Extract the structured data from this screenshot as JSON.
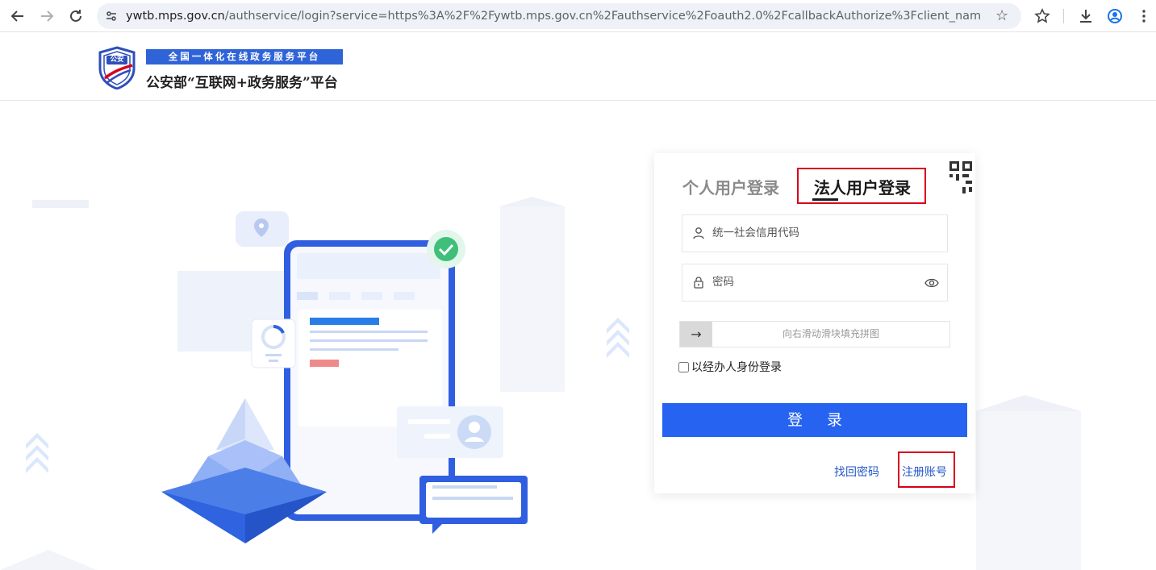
{
  "browser": {
    "url_host": "ywtb.mps.gov.cn",
    "url_rest": "/authservice/login?service=https%3A%2F%2Fywtb.mps.gov.cn%2Fauthservice%2Foauth2.0%2FcallbackAuthorize%3Fclient_name%3DCasO..."
  },
  "header": {
    "badge_text": "公安",
    "tagline": "全国一体化在线政务服务平台",
    "title": "公安部“互联网+政务服务”平台"
  },
  "login": {
    "tabs": [
      "个人用户登录",
      "法人用户登录"
    ],
    "active_tab": 1,
    "credit_code_placeholder": "统一社会信用代码",
    "password_placeholder": "密码",
    "slider_arrow": "→",
    "slider_text": "向右滑动滑块填充拼图",
    "agent_label": "以经办人身份登录",
    "agent_checked": false,
    "submit_label": "登 录",
    "forgot_label": "找回密码",
    "register_label": "注册账号"
  },
  "colors": {
    "primary": "#2563f0",
    "highlight_box": "#d9001b",
    "tagline_bg": "#2f63d8"
  }
}
